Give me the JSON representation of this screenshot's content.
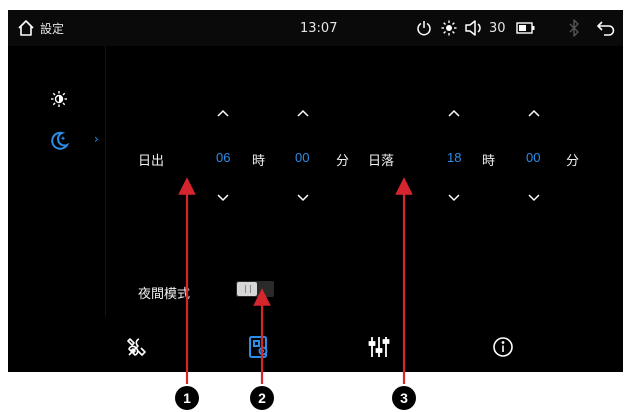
{
  "status_bar": {
    "title": "設定",
    "time": "13:07",
    "volume": "30"
  },
  "icons": {
    "home": "home-icon",
    "power": "power-icon",
    "brightness": "brightness-icon",
    "volume": "speaker-icon",
    "battery": "battery-icon",
    "bluetooth": "bluetooth-icon",
    "back": "back-arrow-icon"
  },
  "sidebar": {
    "items": [
      {
        "icon": "brightness-icon",
        "active": false
      },
      {
        "icon": "night-moon-icon",
        "active": true
      }
    ],
    "active_arrow": "›"
  },
  "sunrise": {
    "label": "日出",
    "hour": "06",
    "hour_unit": "時",
    "minute": "00",
    "minute_unit": "分"
  },
  "sunset": {
    "label": "日落",
    "hour": "18",
    "hour_unit": "時",
    "minute": "00",
    "minute_unit": "分"
  },
  "night_mode": {
    "label": "夜間模式",
    "enabled": false
  },
  "bottom_tabs": [
    {
      "icon": "tools-icon",
      "active": false
    },
    {
      "icon": "display-settings-icon",
      "active": true
    },
    {
      "icon": "equalizer-icon",
      "active": false
    },
    {
      "icon": "info-icon",
      "active": false
    }
  ],
  "annotations": [
    {
      "number": "1"
    },
    {
      "number": "2"
    },
    {
      "number": "3"
    }
  ],
  "colors": {
    "accent": "#2b8de6",
    "background": "#000000",
    "annotation_arrow": "#d6262d",
    "text": "#f0f0f0"
  }
}
